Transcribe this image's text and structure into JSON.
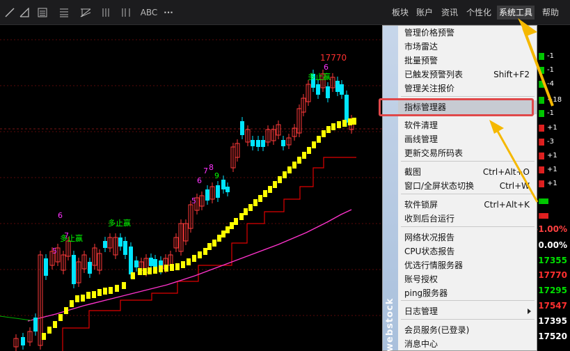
{
  "toolbar": {
    "abc_label": "ABC",
    "more_label": "···",
    "menus": [
      {
        "label": "板块"
      },
      {
        "label": "账户"
      },
      {
        "label": "资讯"
      },
      {
        "label": "个性化"
      },
      {
        "label": "系统工具"
      },
      {
        "label": "帮助"
      }
    ],
    "active_menu": "系统工具"
  },
  "dropdown": {
    "watermark": "webstock",
    "items": [
      {
        "label": "管理价格预警",
        "shortcut": ""
      },
      {
        "label": "市场雷达",
        "shortcut": ""
      },
      {
        "label": "批量预警",
        "shortcut": ""
      },
      {
        "label": "已触发预警列表",
        "shortcut": "Shift+F2"
      },
      {
        "label": "管理关注报价",
        "shortcut": ""
      },
      {
        "label": "指标管理器",
        "shortcut": ""
      },
      {
        "label": "软件清理",
        "shortcut": ""
      },
      {
        "label": "画线管理",
        "shortcut": ""
      },
      {
        "label": "更新交易所码表",
        "shortcut": ""
      },
      {
        "label": "截图",
        "shortcut": "Ctrl+Alt+O"
      },
      {
        "label": "窗口/全屏状态切换",
        "shortcut": "Ctrl+W"
      },
      {
        "label": "软件锁屏",
        "shortcut": "Ctrl+Alt+K"
      },
      {
        "label": "收到后台运行",
        "shortcut": ""
      },
      {
        "label": "网络状况报告",
        "shortcut": ""
      },
      {
        "label": "CPU状态报告",
        "shortcut": ""
      },
      {
        "label": "优选行情服务器",
        "shortcut": ""
      },
      {
        "label": "账号授权",
        "shortcut": ""
      },
      {
        "label": "ping服务器",
        "shortcut": ""
      },
      {
        "label": "日志管理",
        "shortcut": ""
      },
      {
        "label": "会员服务(已登录)",
        "shortcut": ""
      },
      {
        "label": "消息中心",
        "shortcut": ""
      }
    ],
    "highlighted_item": "指标管理器"
  },
  "chart": {
    "peak_label": "17770",
    "signal_label": "多止赢",
    "sequence_labels": [
      "5",
      "6",
      "7",
      "5",
      "6",
      "7",
      "8",
      "9",
      "6"
    ],
    "colors": {
      "up_candle": "#ff3a3a",
      "down_candle": "#00e5ff",
      "trail_stop": "#ffff00",
      "step_line": "#e00000",
      "ma_line": "#ff33cc",
      "signal_text": "#00ff00",
      "seq_text": "#ff33ff"
    }
  },
  "right_panel": {
    "tags": [
      {
        "text": "-1",
        "color": "#00c800"
      },
      {
        "text": "-1",
        "color": "#00c800"
      },
      {
        "text": "-4",
        "color": "#00c800"
      },
      {
        "text": "+18",
        "color": "#00c800"
      },
      {
        "text": "-1",
        "color": "#00c800"
      },
      {
        "text": "+1",
        "color": "#e02020"
      },
      {
        "text": "-3",
        "color": "#e02020"
      },
      {
        "text": "+1",
        "color": "#e02020"
      },
      {
        "text": "+1",
        "color": "#e02020"
      },
      {
        "text": "+1",
        "color": "#e02020"
      }
    ],
    "values": [
      {
        "text": "/-1.00%",
        "color": "#ff4040"
      },
      {
        "text": "0.00%",
        "color": "#ffffff"
      },
      {
        "text": "17355",
        "color": "#00e000"
      },
      {
        "text": "17770",
        "color": "#ff3030"
      },
      {
        "text": "17295",
        "color": "#00e000"
      },
      {
        "text": "17547",
        "color": "#ff3030"
      },
      {
        "text": "17395",
        "color": "#ffffff"
      },
      {
        "text": "17520",
        "color": "#ffffff"
      }
    ]
  },
  "annotations": {
    "box_color": "#e0484a",
    "arrow_color": "#f5b800"
  }
}
